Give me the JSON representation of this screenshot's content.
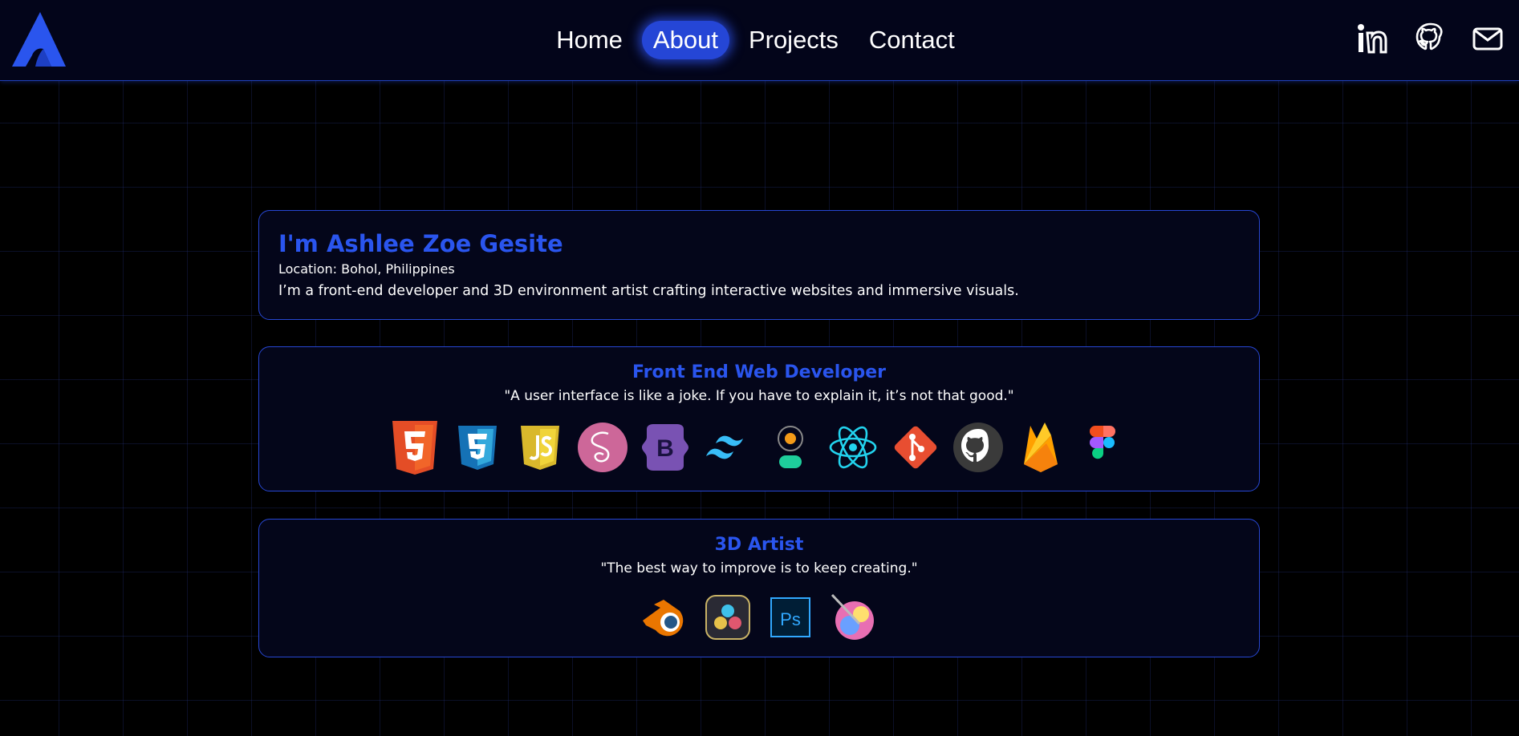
{
  "nav": {
    "links": [
      {
        "label": "Home",
        "active": false
      },
      {
        "label": "About",
        "active": true
      },
      {
        "label": "Projects",
        "active": false
      },
      {
        "label": "Contact",
        "active": false
      }
    ],
    "social_icons": [
      "linkedin-icon",
      "github-icon",
      "mail-icon"
    ],
    "logo_icon": "logo-icon"
  },
  "intro": {
    "name": "I'm Ashlee Zoe Gesite",
    "location": "Location: Bohol, Philippines",
    "description": "I’m a front-end developer and 3D environment artist crafting interactive websites and immersive visuals."
  },
  "frontend": {
    "title": "Front End Web Developer",
    "quote": "\"A user interface is like a joke. If you have to explain it, it’s not that good.\"",
    "icons": [
      "html5-icon",
      "css3-icon",
      "javascript-icon",
      "sass-icon",
      "bootstrap-icon",
      "tailwind-icon",
      "greensock-icon",
      "react-icon",
      "git-icon",
      "github-icon",
      "firebase-icon",
      "figma-icon"
    ]
  },
  "artist": {
    "title": "3D Artist",
    "quote": "\"The best way to improve is to keep creating.\"",
    "icons": [
      "blender-icon",
      "davinci-resolve-icon",
      "photoshop-icon",
      "krita-icon"
    ]
  },
  "colors": {
    "accent": "#2a55ee",
    "active_pill": "#2546d6",
    "border": "#2747d4",
    "background": "#000000",
    "card": "#04061a"
  }
}
